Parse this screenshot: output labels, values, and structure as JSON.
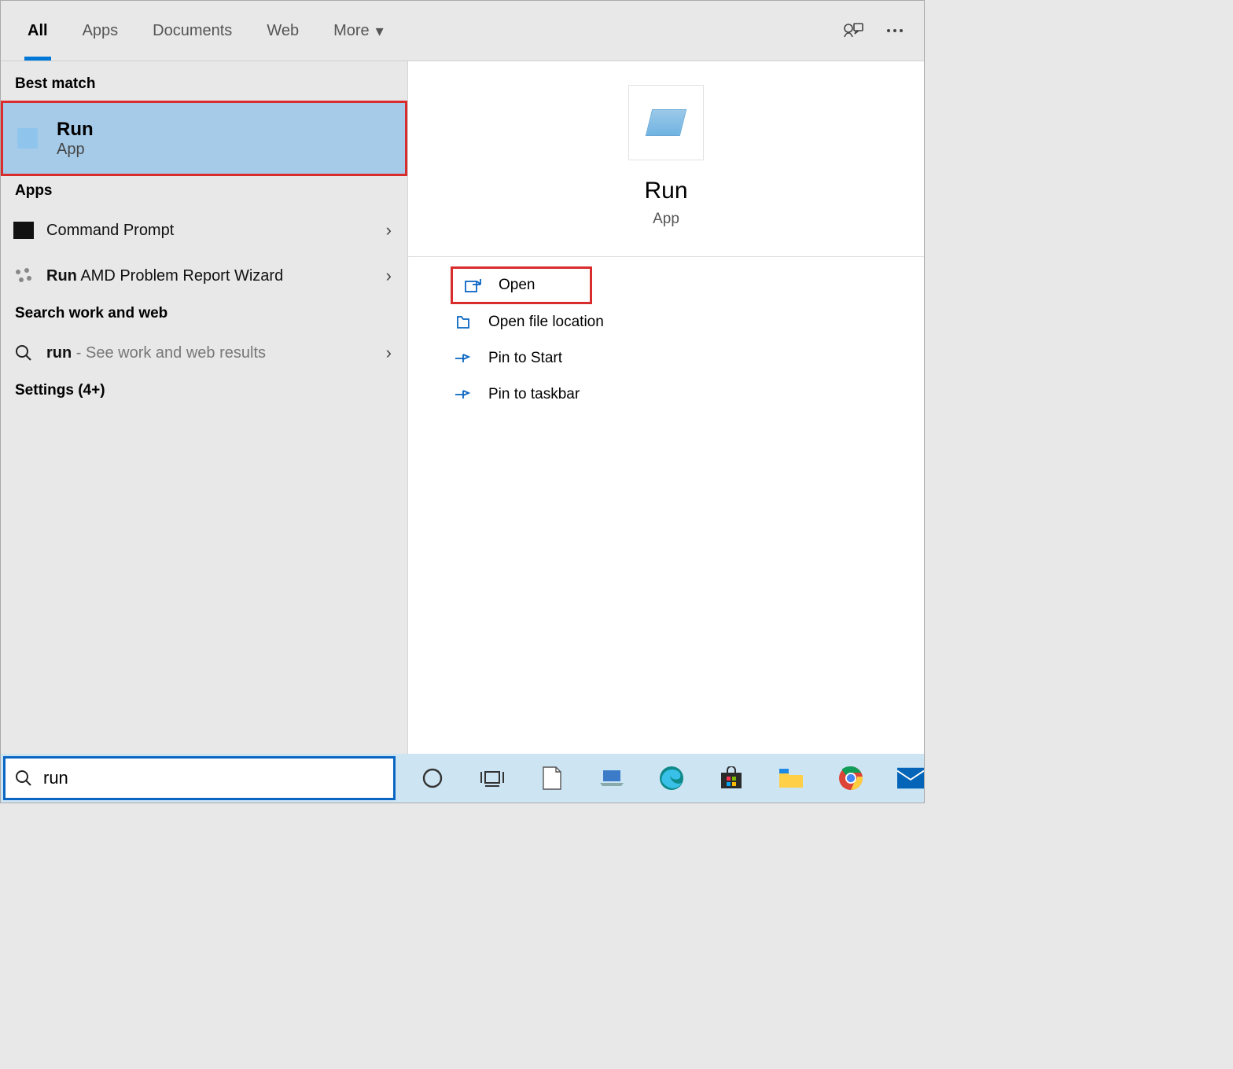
{
  "tabs": {
    "items": [
      "All",
      "Apps",
      "Documents",
      "Web",
      "More"
    ],
    "active": "All"
  },
  "left": {
    "best_match_header": "Best match",
    "best_match": {
      "title": "Run",
      "subtitle": "App"
    },
    "apps_header": "Apps",
    "apps": [
      {
        "name": "Command Prompt",
        "bold_prefix": ""
      },
      {
        "bold": "Run",
        "rest": " AMD Problem Report Wizard"
      }
    ],
    "search_section": "Search work and web",
    "web_item": {
      "bold": "run",
      "rest": " - See work and web results"
    },
    "settings": "Settings (4+)"
  },
  "detail": {
    "title": "Run",
    "subtitle": "App",
    "actions": [
      {
        "label": "Open",
        "icon": "open",
        "highlight": true
      },
      {
        "label": "Open file location",
        "icon": "folder"
      },
      {
        "label": "Pin to Start",
        "icon": "pin"
      },
      {
        "label": "Pin to taskbar",
        "icon": "pin"
      }
    ]
  },
  "search": {
    "value": "run"
  }
}
